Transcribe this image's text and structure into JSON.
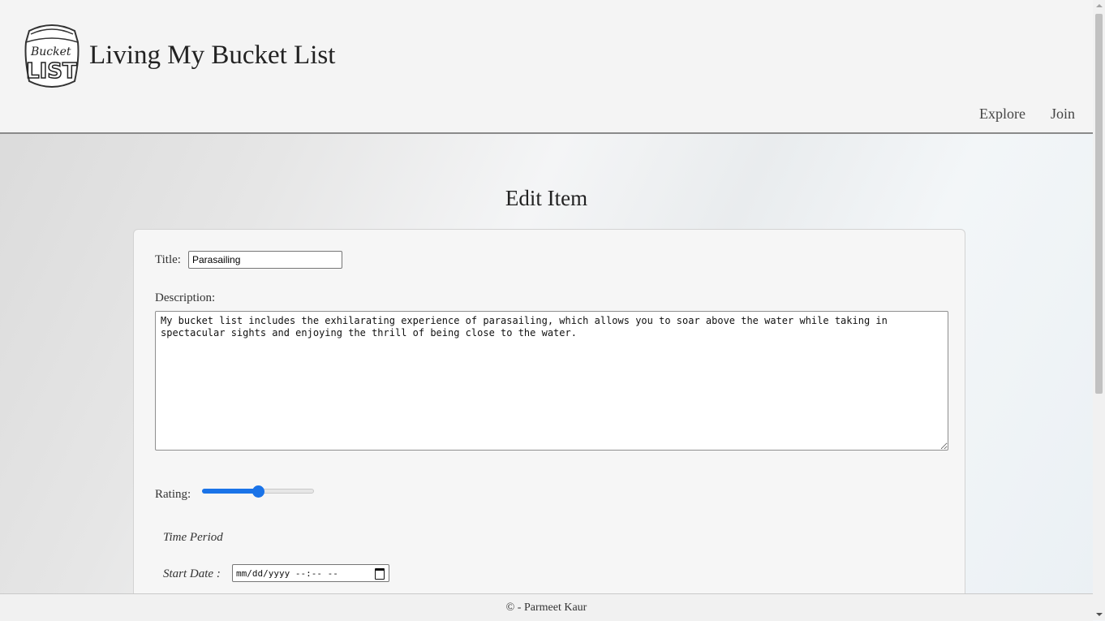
{
  "header": {
    "logo_text": "Bucket LIST",
    "site_title": "Living My Bucket List",
    "nav": [
      "Explore",
      "Join"
    ]
  },
  "page": {
    "heading": "Edit Item"
  },
  "form": {
    "title_label": "Title:",
    "title_value": "Parasailing",
    "description_label": "Description:",
    "description_value": "My bucket list includes the exhilarating experience of parasailing, which allows you to soar above the water while taking in spectacular sights and enjoying the thrill of being close to the water.",
    "rating_label": "Rating:",
    "rating_value": 50,
    "rating_min": 0,
    "rating_max": 100,
    "time_period_label": "Time Period",
    "start_date_label": "Start Date :",
    "start_date_placeholder": "mm/dd/yyyy --:-- --"
  },
  "footer": {
    "text": "© - Parmeet Kaur"
  },
  "colors": {
    "accent": "#1a73e8",
    "header_bg": "#f4f4f4",
    "card_bg": "#f6f6f6"
  }
}
